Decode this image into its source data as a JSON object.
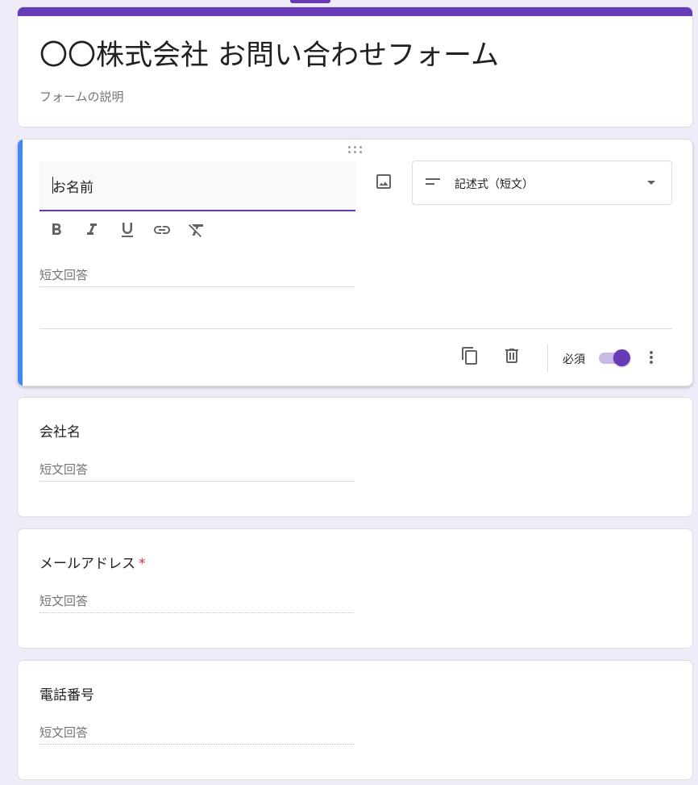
{
  "form": {
    "title": "〇〇株式会社 お問い合わせフォーム",
    "description": "フォームの説明"
  },
  "active_question": {
    "title": "お名前",
    "type_label": "記述式（短文）",
    "answer_hint": "短文回答",
    "required_label": "必須",
    "required": true
  },
  "questions": [
    {
      "title": "会社名",
      "answer_hint": "短文回答",
      "required": false
    },
    {
      "title": "メールアドレス",
      "answer_hint": "短文回答",
      "required": true,
      "required_mark": "*"
    },
    {
      "title": "電話番号",
      "answer_hint": "短文回答",
      "required": false
    }
  ],
  "icons": {
    "image": "image-icon",
    "type": "short-answer-icon",
    "bold": "bold-icon",
    "italic": "italic-icon",
    "underline": "underline-icon",
    "link": "link-icon",
    "clear_format": "clear-format-icon",
    "copy": "copy-icon",
    "delete": "trash-icon",
    "more": "more-vert-icon"
  },
  "colors": {
    "accent": "#673ab7",
    "active_bar": "#4285f4",
    "background": "#f0ebf8",
    "required": "#d93025"
  }
}
